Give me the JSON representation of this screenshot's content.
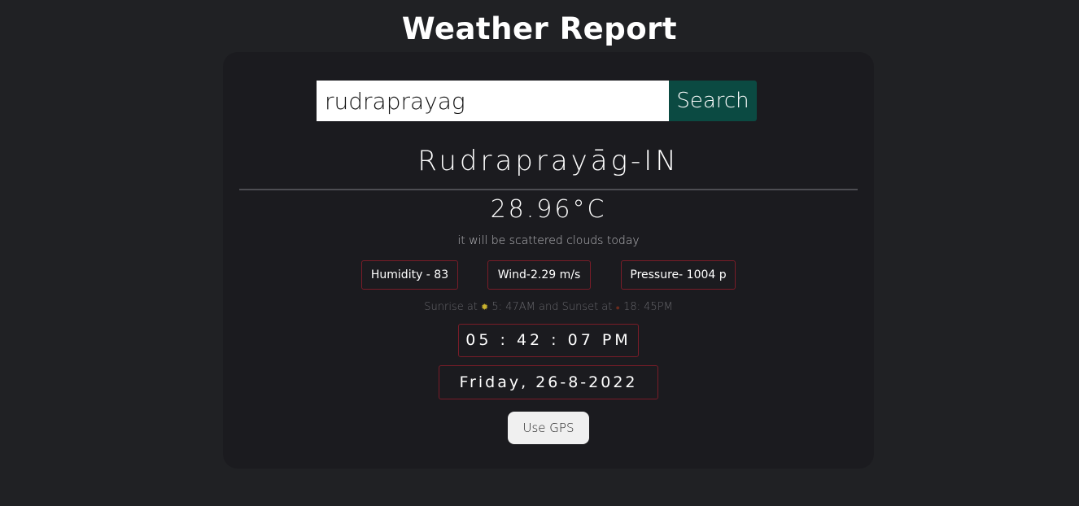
{
  "header": {
    "title": "Weather Report"
  },
  "search": {
    "value": "rudraprayag",
    "button_label": "Search"
  },
  "weather": {
    "city": "Rudraprayāg-IN",
    "temperature": "28.96°C",
    "description": "it will be scattered clouds today",
    "humidity": "Humidity - 83",
    "wind": "Wind-2.29 m/s",
    "pressure": "Pressure- 1004 p"
  },
  "sun": {
    "sunrise_prefix": "Sunrise at",
    "sunrise_icon": "sun-icon",
    "sunrise_time": "5: 47AM",
    "sunset_prefix": "and Sunset at",
    "sunset_icon": "sunset-icon",
    "sunset_time": "18: 45PM"
  },
  "clock": {
    "time": "05 : 42 : 07 PM",
    "date": "Friday, 26-8-2022"
  },
  "gps": {
    "button_label": "Use GPS"
  },
  "colors": {
    "background": "#202124",
    "card": "#1b1b1f",
    "search_button": "#0b4a42",
    "border_accent": "#7a1c28"
  }
}
